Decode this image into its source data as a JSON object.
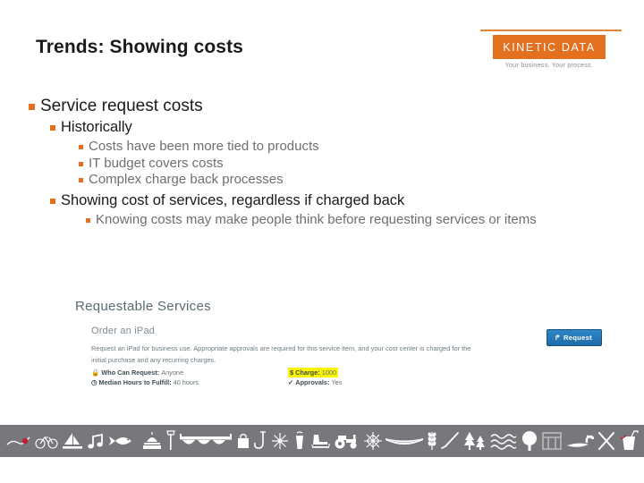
{
  "slide": {
    "title": "Trends: Showing costs"
  },
  "logo": {
    "name": "KINETIC DATA",
    "tagline": "Your business. Your process.",
    "box_color": "#e2701e",
    "rule_color": "#e0873c"
  },
  "bullets": [
    {
      "level": 1,
      "text": "Service request costs"
    },
    {
      "level": 2,
      "text": "Historically"
    },
    {
      "level": 3,
      "text": "Costs have been more tied to products"
    },
    {
      "level": 3,
      "text": "IT budget covers costs"
    },
    {
      "level": 3,
      "text": "Complex charge back processes"
    },
    {
      "level": 2,
      "text": "Showing cost of services, regardless if charged back"
    },
    {
      "level": 3,
      "text": "Knowing costs may make people think before requesting services or items"
    }
  ],
  "bullet_color": "#e2701e",
  "embed": {
    "heading": "Requestable Services",
    "service_name": "Order an iPad",
    "description": "Request an iPad for business use. Appropriate approvals are required for this service item, and your cost center is charged for the initial purchase and any recurring charges.",
    "meta": [
      {
        "icon": "lock-icon",
        "glyph": "ὑ2",
        "label": "Who Can Request:",
        "value": "Anyone",
        "highlight": false
      },
      {
        "icon": "dollar-icon",
        "glyph": "$",
        "label": "Charge:",
        "value": "1000",
        "highlight": true
      },
      {
        "icon": "clock-icon",
        "glyph": "○",
        "label": "Median Hours to Fulfill:",
        "value": "40 hours",
        "highlight": false
      },
      {
        "icon": "check-icon",
        "glyph": "✓",
        "label": "Approvals:",
        "value": "Yes",
        "highlight": false
      }
    ],
    "request_button": {
      "label": "Request",
      "arrow": "↱",
      "color": "#2e86c6"
    }
  },
  "footer": {
    "background": "#76787b",
    "accent": "#c02033",
    "icons": [
      "fishing-lure-icon",
      "bicycle-icon",
      "sailboat-icon",
      "music-note-icon",
      "fish-icon",
      "capitol-dome-icon",
      "lamp-post-icon",
      "bridge-icon",
      "handbag-icon",
      "fish-hook-icon",
      "fireworks-icon",
      "coffee-cup-icon",
      "ice-skate-icon",
      "tractor-icon",
      "snowflake-icon",
      "canoe-icon",
      "wheat-icon",
      "hockey-stick-icon",
      "pine-trees-icon",
      "waves-icon",
      "tree-icon",
      "bridge-arch-icon",
      "loon-icon",
      "skis-icon",
      "drink-cup-icon"
    ]
  }
}
